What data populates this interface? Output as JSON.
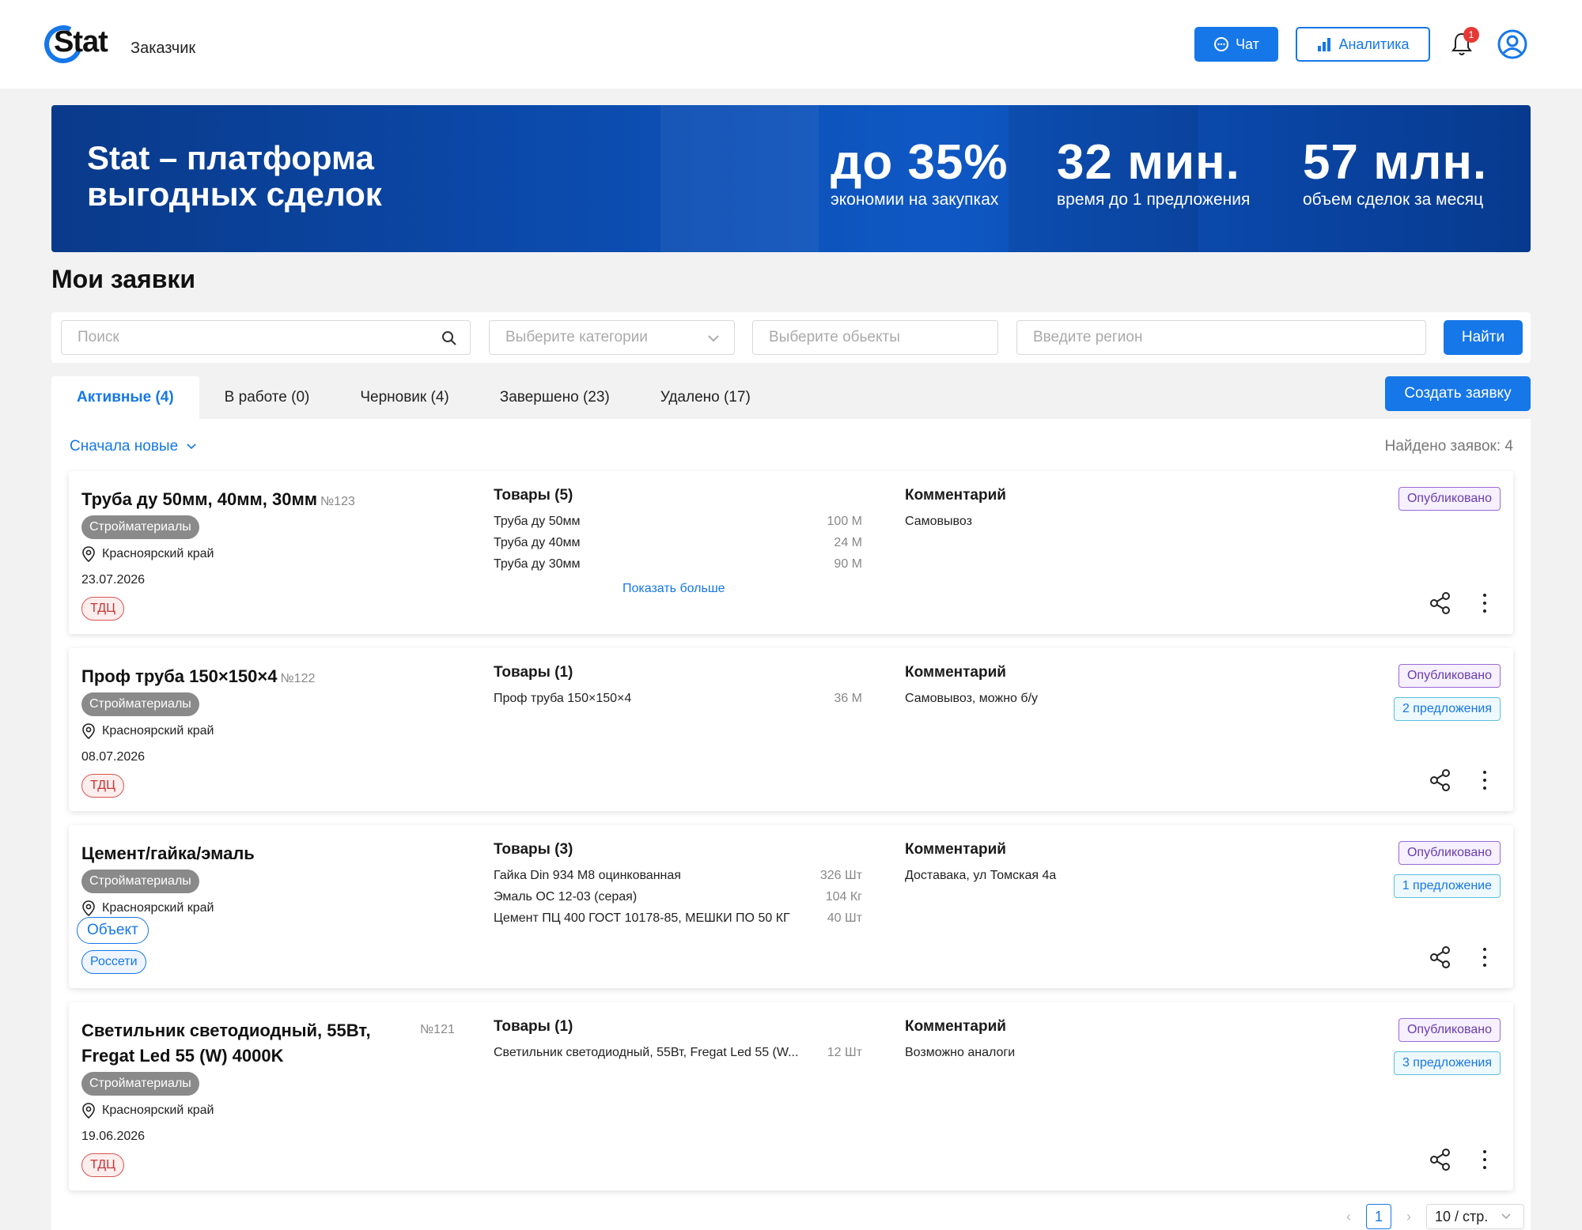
{
  "header": {
    "logo_text": "Stat",
    "role": "Заказчик",
    "chat_label": "Чат",
    "analytics_label": "Аналитика",
    "notification_count": "1",
    "accent_color": "#1677e8"
  },
  "banner": {
    "title_line1": "Stat – платформа",
    "title_line2": "выгодных сделок",
    "stats": [
      {
        "value": "до 35%",
        "label": "экономии на закупках"
      },
      {
        "value": "32 мин.",
        "label": "время до 1 предложения"
      },
      {
        "value": "57 млн.",
        "label": "объем сделок за месяц"
      }
    ]
  },
  "page_title": "Мои заявки",
  "filters": {
    "search_placeholder": "Поиск",
    "category_placeholder": "Выберите категории",
    "objects_placeholder": "Выберите обьекты",
    "region_placeholder": "Введите регион",
    "find_label": "Найти"
  },
  "tabs": [
    {
      "label": "Активные (4)",
      "active": true
    },
    {
      "label": "В работе (0)",
      "active": false
    },
    {
      "label": "Черновик (4)",
      "active": false
    },
    {
      "label": "Завершено (23)",
      "active": false
    },
    {
      "label": "Удалено (17)",
      "active": false
    }
  ],
  "create_label": "Создать заявку",
  "sort_label": "Сначала новые",
  "found_label": "Найдено заявок: 4",
  "cards": [
    {
      "title": "Труба ду 50мм, 40мм, 30мм",
      "number": "№123",
      "category": "Стройматериалы",
      "region": "Красноярский край",
      "date": "23.07.2026",
      "tag": "ТДЦ",
      "goods_header": "Товары (5)",
      "goods": [
        {
          "name": "Труба ду 50мм",
          "qty": "100 М"
        },
        {
          "name": "Труба ду 40мм",
          "qty": "24 М"
        },
        {
          "name": "Труба ду 30мм",
          "qty": "90 М"
        }
      ],
      "show_more": "Показать больше",
      "comment_header": "Комментарий",
      "comment": "Самовывоз",
      "status": "Опубликовано",
      "offers": ""
    },
    {
      "title": "Проф труба 150×150×4",
      "number": "№122",
      "category": "Стройматериалы",
      "region": "Красноярский край",
      "date": "08.07.2026",
      "tag": "ТДЦ",
      "goods_header": "Товары (1)",
      "goods": [
        {
          "name": "Проф труба 150×150×4",
          "qty": "36 М"
        }
      ],
      "comment_header": "Комментарий",
      "comment": "Самовывоз, можно б/у",
      "status": "Опубликовано",
      "offers": "2 предложения"
    },
    {
      "title": "Цемент/гайка/эмаль",
      "number": "",
      "category": "Стройматериалы",
      "region": "Красноярский край",
      "object_tag": "Объект",
      "tag2": "Россети",
      "goods_header": "Товары (3)",
      "goods": [
        {
          "name": "Гайка Din 934 М8 оцинкованная",
          "qty": "326 Шт"
        },
        {
          "name": "Эмаль ОС 12-03 (серая)",
          "qty": "104 Кг"
        },
        {
          "name": "Цемент ПЦ 400 ГОСТ 10178-85, МЕШКИ ПО 50 КГ",
          "qty": "40 Шт"
        }
      ],
      "comment_header": "Комментарий",
      "comment": "Доставака, ул Томская 4а",
      "status": "Опубликовано",
      "offers": "1 предложение"
    },
    {
      "title_line1": "Светильник светодиодный, 55Вт,",
      "title_line2": "Fregat Led 55 (W) 4000K",
      "number": "№121",
      "category": "Стройматериалы",
      "region": "Красноярский край",
      "date": "19.06.2026",
      "tag": "ТДЦ",
      "goods_header": "Товары (1)",
      "goods": [
        {
          "name": "Светильник светодиодный, 55Вт, Fregat Led 55 (W...",
          "qty": "12 Шт"
        }
      ],
      "comment_header": "Комментарий",
      "comment": "Возможно аналоги",
      "status": "Опубликовано",
      "offers": "3 предложения"
    }
  ],
  "pagination": {
    "current_page": "1",
    "page_size": "10 / стр."
  }
}
